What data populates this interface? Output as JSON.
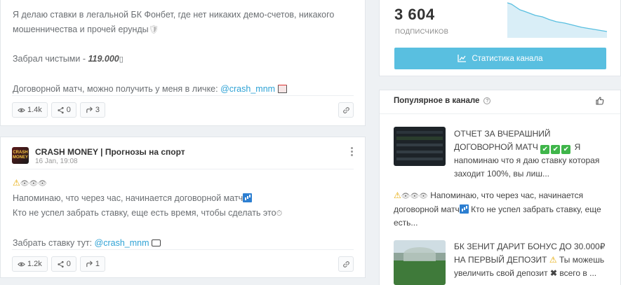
{
  "post1": {
    "line1": "Я делаю ставки в легальной БК Фонбет, где нет никаких демо-счетов, никакого",
    "line2": "мошенничества и прочей ерунды",
    "line3_prefix": "Забрал чистыми - ",
    "line3_amount": "119.000",
    "line4_prefix": "Договорной матч, можно получить у меня в личке: ",
    "line4_link": "@crash_mnm",
    "views": "1.4k",
    "shares": "0",
    "reposts": "3"
  },
  "post2": {
    "channel_name": "CRASH MONEY | Прогнозы на спорт",
    "avatar_text": "CRASH MONEY",
    "date": "16 Jan, 19:08",
    "line1": "Напоминаю, что через час, начинается договорной матч",
    "line2": "Кто не успел забрать ставку, еще есть время, чтобы сделать это",
    "line3_prefix": "Забрать ставку тут: ",
    "line3_link": "@crash_mnm",
    "views": "1.2k",
    "shares": "0",
    "reposts": "1"
  },
  "channel_stats": {
    "subscribers": "3 604",
    "subscribers_label": "ПОДПИСЧИКОВ",
    "stats_button": "Статистика канала",
    "accent_color": "#59bfe0"
  },
  "popular": {
    "title": "Популярное в канале",
    "items": [
      {
        "line1": "ОТЧЕТ ЗА ВЧЕРАШНИЙ",
        "line2": "ДОГОВОРНОЙ МАТЧ",
        "line2_suffix": "Я",
        "line3": "напоминаю что я даю ставку которая",
        "line4": "заходит 100%, вы лиш..."
      },
      {
        "line1": "Напоминаю, что через час, начинается",
        "line2": "договорной матч",
        "line2_suffix": "Кто не успел забрать ставку, еще",
        "line3": "есть..."
      },
      {
        "line1": "БК ЗЕНИТ ДАРИТ БОНУС ДО 30.000₽",
        "line2": "НА ПЕРВЫЙ ДЕПОЗИТ",
        "line2_suffix": "Ты можешь",
        "line3_prefix": "увеличить свой депозит",
        "line3_suffix": "всего в ..."
      }
    ]
  }
}
